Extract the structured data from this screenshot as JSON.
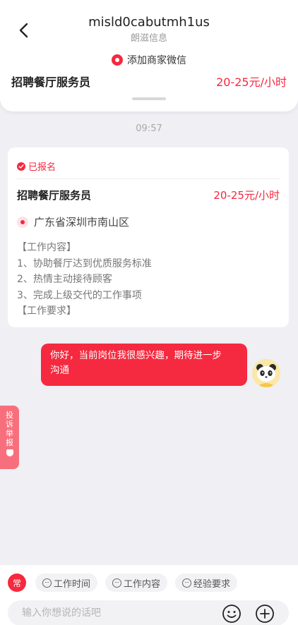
{
  "header": {
    "title": "misld0cabutmh1us",
    "subtitle": "朗滋信息",
    "add_wechat_label": "添加商家微信",
    "job_title": "招聘餐厅服务员",
    "job_salary": "20-25元/小时"
  },
  "chat": {
    "time": "09:57",
    "card": {
      "status": "已报名",
      "job_title": "招聘餐厅服务员",
      "job_salary": "20-25元/小时",
      "location": "广东省深圳市南山区",
      "description": [
        "【工作内容】",
        "1、协助餐厅达到优质服务标准",
        "2、热情主动接待顾客",
        "3、完成上级交代的工作事项",
        "【工作要求】"
      ]
    },
    "message": {
      "line1": "你好，当前岗位我很感兴趣，期待进一步",
      "line2": "沟通"
    }
  },
  "report_tab": {
    "chars": [
      "投",
      "诉",
      "举",
      "报"
    ]
  },
  "bottom": {
    "badge": "常",
    "chips": [
      "工作时间",
      "工作内容",
      "经验要求"
    ],
    "input_placeholder": "输入你想说的话吧"
  },
  "colors": {
    "accent": "#f5293f",
    "background": "#efeff4"
  }
}
